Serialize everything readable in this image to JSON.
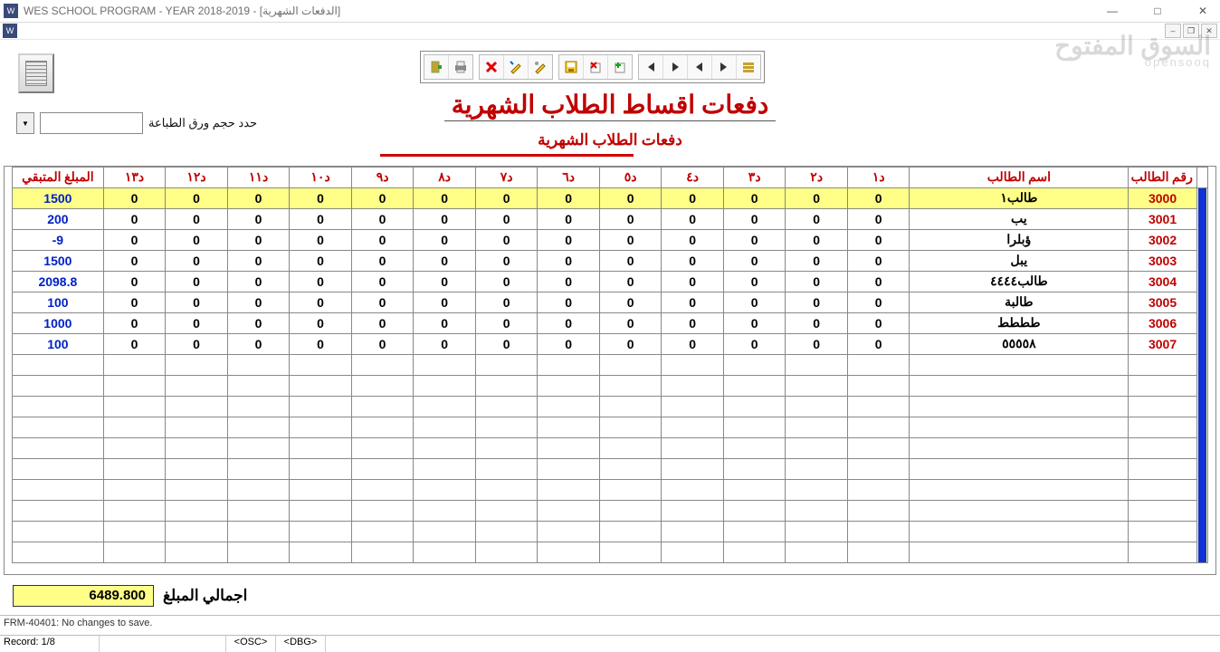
{
  "window": {
    "title": "WES SCHOOL PROGRAM - YEAR 2018-2019 - [الدفعات الشهرية]",
    "min": "—",
    "max": "□",
    "close": "✕",
    "mdi_min": "–",
    "mdi_max": "❐",
    "mdi_close": "✕"
  },
  "watermark": {
    "l1": "السوق المفتوح",
    "l2": "opensooq"
  },
  "paper": {
    "label": "حدد حجم ورق الطباعة",
    "value": ""
  },
  "heading": "دفعات اقساط الطلاب الشهرية",
  "subheading": "دفعات الطلاب الشهرية",
  "columns": {
    "balance": "المبلغ المتبقي",
    "d13": "د١٣",
    "d12": "د١٢",
    "d11": "د١١",
    "d10": "د١٠",
    "d9": "د٩",
    "d8": "د٨",
    "d7": "د٧",
    "d6": "د٦",
    "d5": "د٥",
    "d4": "د٤",
    "d3": "د٣",
    "d2": "د٢",
    "d1": "د١",
    "name": "اسم الطالب",
    "id": "رقم الطالب"
  },
  "rows": [
    {
      "id": "3000",
      "name": "طالب١",
      "d": [
        "0",
        "0",
        "0",
        "0",
        "0",
        "0",
        "0",
        "0",
        "0",
        "0",
        "0",
        "0",
        "0"
      ],
      "bal": "1500",
      "sel": true
    },
    {
      "id": "3001",
      "name": "يب",
      "d": [
        "0",
        "0",
        "0",
        "0",
        "0",
        "0",
        "0",
        "0",
        "0",
        "0",
        "0",
        "0",
        "0"
      ],
      "bal": "200"
    },
    {
      "id": "3002",
      "name": "ؤبلرا",
      "d": [
        "0",
        "0",
        "0",
        "0",
        "0",
        "0",
        "0",
        "0",
        "0",
        "0",
        "0",
        "0",
        "0"
      ],
      "bal": "-9"
    },
    {
      "id": "3003",
      "name": "يبل",
      "d": [
        "0",
        "0",
        "0",
        "0",
        "0",
        "0",
        "0",
        "0",
        "0",
        "0",
        "0",
        "0",
        "0"
      ],
      "bal": "1500"
    },
    {
      "id": "3004",
      "name": "طالب٤٤٤٤",
      "d": [
        "0",
        "0",
        "0",
        "0",
        "0",
        "0",
        "0",
        "0",
        "0",
        "0",
        "0",
        "0",
        "0"
      ],
      "bal": "2098.8"
    },
    {
      "id": "3005",
      "name": "طالبة",
      "d": [
        "0",
        "0",
        "0",
        "0",
        "0",
        "0",
        "0",
        "0",
        "0",
        "0",
        "0",
        "0",
        "0"
      ],
      "bal": "100"
    },
    {
      "id": "3006",
      "name": "طططط",
      "d": [
        "0",
        "0",
        "0",
        "0",
        "0",
        "0",
        "0",
        "0",
        "0",
        "0",
        "0",
        "0",
        "0"
      ],
      "bal": "1000"
    },
    {
      "id": "3007",
      "name": "٥٥٥٥٨",
      "d": [
        "0",
        "0",
        "0",
        "0",
        "0",
        "0",
        "0",
        "0",
        "0",
        "0",
        "0",
        "0",
        "0"
      ],
      "bal": "100"
    }
  ],
  "empty_rows": 10,
  "total": {
    "label": "اجمالي المبلغ",
    "value": "6489.800"
  },
  "status": {
    "msg": "FRM-40401: No changes to save.",
    "record": "Record: 1/8",
    "osc": "<OSC>",
    "dbg": "<DBG>"
  },
  "toolbar": {
    "exit": "exit",
    "print": "print",
    "delete": "delete",
    "edit": "edit",
    "commit": "commit",
    "save": "save",
    "rollback": "rollback",
    "insert": "insert",
    "first": "first",
    "next": "next",
    "prev": "prev",
    "last": "last",
    "list": "list"
  }
}
